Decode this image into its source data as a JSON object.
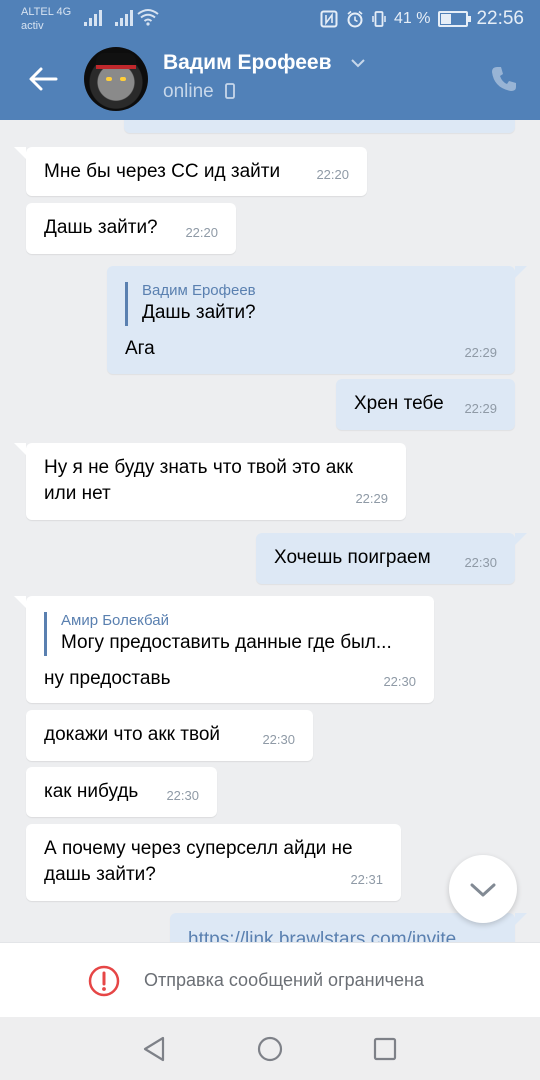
{
  "status_bar": {
    "carrier_line1": "ALTEL 4G",
    "carrier_line2": "activ",
    "battery": "41 %",
    "time": "22:56"
  },
  "header": {
    "contact_name": "Вадим Ерофеев",
    "presence": "online",
    "back_icon": "arrow-left-icon",
    "call_icon": "phone-icon"
  },
  "colors": {
    "header": "#5181b8",
    "incoming_bubble": "#ffffff",
    "outgoing_bubble": "#dde8f5",
    "background": "#edeef0",
    "alert": "#e64646"
  },
  "messages": [
    {
      "id": "m1",
      "dir": "in",
      "text": "Мне бы через СС ид зайти",
      "time": "22:20"
    },
    {
      "id": "m2",
      "dir": "in",
      "text": "Дашь зайти?",
      "time": "22:20"
    },
    {
      "id": "m3",
      "dir": "out",
      "reply_to": {
        "author": "Вадим Ерофеев",
        "text": "Дашь зайти?"
      },
      "text": "Ага",
      "time": "22:29"
    },
    {
      "id": "m4",
      "dir": "out",
      "text": "Хрен тебе",
      "time": "22:29"
    },
    {
      "id": "m5",
      "dir": "in",
      "text_line1": "Ну я не буду знать что твой это акк",
      "text_line2": "или нет",
      "time": "22:29"
    },
    {
      "id": "m6",
      "dir": "out",
      "text": "Хочешь поиграем",
      "time": "22:30"
    },
    {
      "id": "m7",
      "dir": "in",
      "reply_to": {
        "author": "Амир Болекбай",
        "text": "Могу предоставить данные где был..."
      },
      "text": "ну предоставь",
      "time": "22:30"
    },
    {
      "id": "m8",
      "dir": "in",
      "text": "докажи что акк твой",
      "time": "22:30"
    },
    {
      "id": "m9",
      "dir": "in",
      "text": "как нибудь",
      "time": "22:30"
    },
    {
      "id": "m10",
      "dir": "in",
      "text_line1": "А почему через суперселл айди не",
      "text_line2": "дашь зайти?",
      "time": "22:31"
    },
    {
      "id": "m11",
      "dir": "out",
      "text": "https://link.brawlstars.com/invite"
    }
  ],
  "restriction": {
    "icon": "alert-circle-icon",
    "text": "Отправка сообщений ограничена"
  },
  "navbar": {
    "back": "nav-back-icon",
    "home": "nav-home-icon",
    "recents": "nav-recents-icon"
  }
}
